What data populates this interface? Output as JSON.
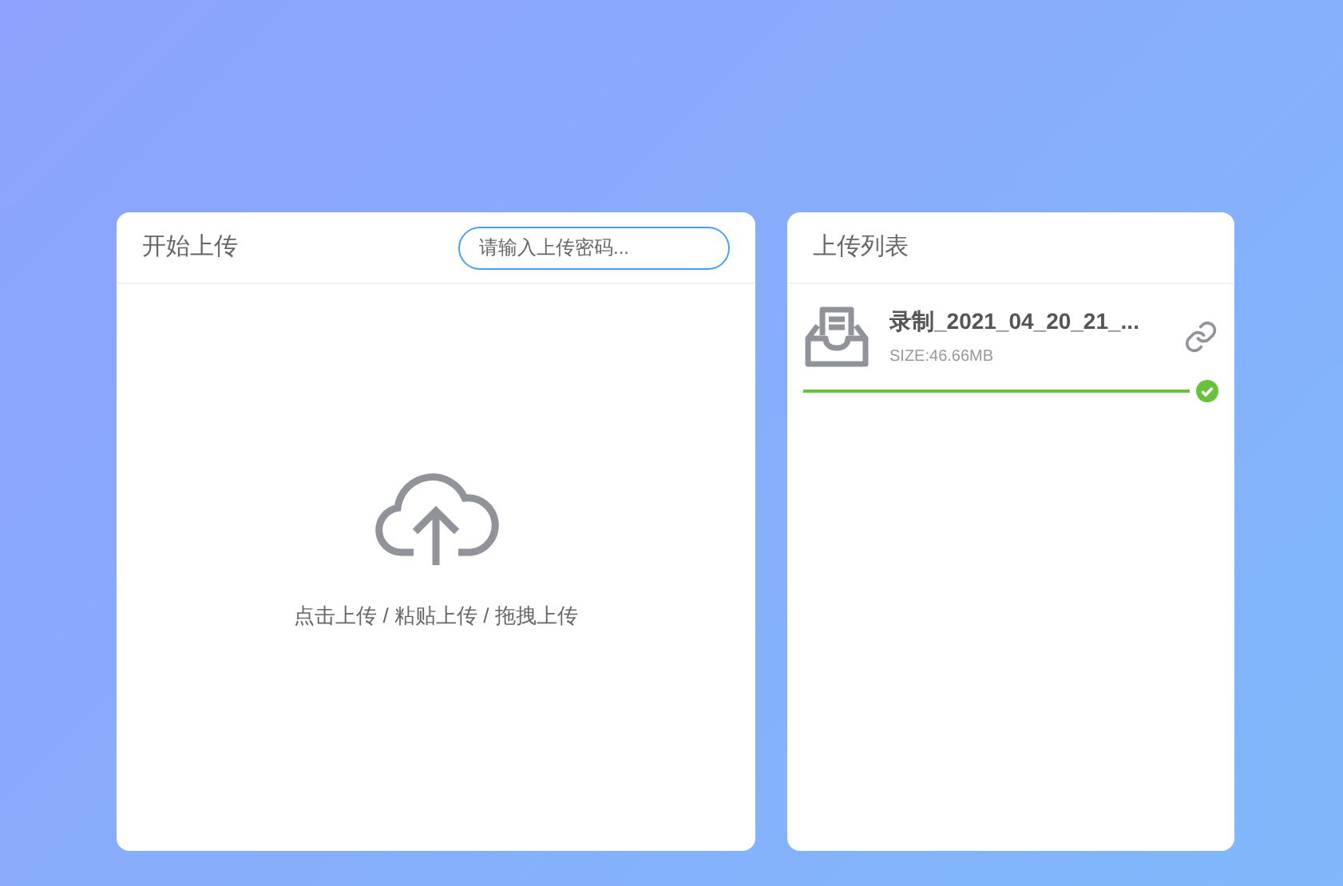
{
  "upload_panel": {
    "title": "开始上传",
    "password_field": {
      "placeholder": "请输入上传密码..."
    },
    "hint": "点击上传 / 粘贴上传 / 拖拽上传"
  },
  "list_panel": {
    "title": "上传列表",
    "files": [
      {
        "name": "录制_2021_04_20_21_...",
        "size": "SIZE:46.66MB",
        "level": 1,
        "done": true
      }
    ]
  }
}
